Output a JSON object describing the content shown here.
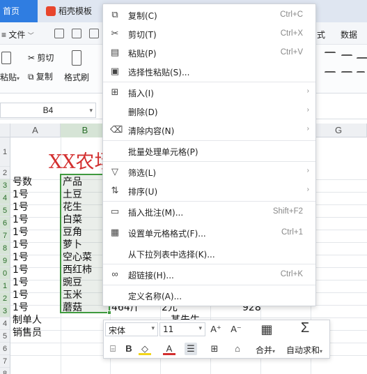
{
  "tabs": {
    "home_label": "首页",
    "template_label": "稻壳模板"
  },
  "menubar": {
    "file_label": "文件",
    "right_tabs": [
      "式",
      "数据"
    ]
  },
  "ribbon": {
    "cut_label": "剪切",
    "copy_label": "复制",
    "paste_label": "粘贴",
    "format_painter_label": "格式刷"
  },
  "formula_bar": {
    "cell_ref": "B4"
  },
  "sheet": {
    "columns": [
      "A",
      "B",
      "C",
      "D",
      "E",
      "F",
      "G"
    ],
    "selected_column": "B",
    "row_numbers": [
      "1",
      "2",
      "3",
      "4",
      "5",
      "6",
      "7",
      "8",
      "9",
      "0",
      "1",
      "2",
      "3",
      "4",
      "5",
      "6",
      "7",
      "8",
      "9"
    ],
    "title": "XX农场",
    "col_a": [
      "号数",
      "1号",
      "1号",
      "1号",
      "1号",
      "1号",
      "1号",
      "1号",
      "1号",
      "1号",
      "1号",
      "制单人",
      "销售员"
    ],
    "col_b": [
      "产品",
      "土豆",
      "花生",
      "白菜",
      "豆角",
      "萝卜",
      "空心菜",
      "西红柿",
      "豌豆",
      "玉米",
      "蘑菇"
    ],
    "row14_extra": [
      "464斤",
      "2元",
      "928"
    ],
    "row15_extra": "某先生"
  },
  "context_menu": {
    "items": [
      {
        "icon": "copy-icon",
        "label": "复制(C)",
        "shortcut": "Ctrl+C",
        "submenu": false
      },
      {
        "icon": "scissors-icon",
        "label": "剪切(T)",
        "shortcut": "Ctrl+X",
        "submenu": false
      },
      {
        "icon": "paste-icon",
        "label": "粘贴(P)",
        "shortcut": "Ctrl+V",
        "submenu": false
      },
      {
        "icon": "paste-special-icon",
        "label": "选择性粘贴(S)...",
        "shortcut": "",
        "submenu": false
      },
      {
        "icon": "insert-icon",
        "label": "插入(I)",
        "shortcut": "",
        "submenu": true
      },
      {
        "icon": "",
        "label": "删除(D)",
        "shortcut": "",
        "submenu": true
      },
      {
        "icon": "eraser-icon",
        "label": "清除内容(N)",
        "shortcut": "",
        "submenu": true
      },
      {
        "icon": "",
        "label": "批量处理单元格(P)",
        "shortcut": "",
        "submenu": false
      },
      {
        "icon": "filter-icon",
        "label": "筛选(L)",
        "shortcut": "",
        "submenu": true
      },
      {
        "icon": "sort-icon",
        "label": "排序(U)",
        "shortcut": "",
        "submenu": true
      },
      {
        "icon": "comment-icon",
        "label": "插入批注(M)...",
        "shortcut": "Shift+F2",
        "submenu": false
      },
      {
        "icon": "format-cells-icon",
        "label": "设置单元格格式(F)...",
        "shortcut": "Ctrl+1",
        "submenu": false
      },
      {
        "icon": "",
        "label": "从下拉列表中选择(K)...",
        "shortcut": "",
        "submenu": false
      },
      {
        "icon": "link-icon",
        "label": "超链接(H)...",
        "shortcut": "Ctrl+K",
        "submenu": false
      },
      {
        "icon": "",
        "label": "定义名称(A)...",
        "shortcut": "",
        "submenu": false
      }
    ]
  },
  "mini_toolbar": {
    "font_name": "宋体",
    "font_size": "11",
    "merge_label": "合并",
    "autosum_label": "自动求和"
  },
  "colors": {
    "accent": "#2f7de1",
    "selection": "#3f9a3f",
    "title_red": "#d32f2f"
  }
}
